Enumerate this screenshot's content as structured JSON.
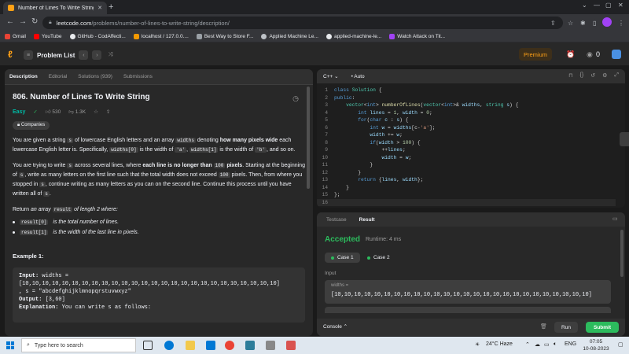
{
  "browser": {
    "tab_title": "Number of Lines To Write String",
    "url_host": "leetcode.com",
    "url_path": "/problems/number-of-lines-to-write-string/description/",
    "bookmarks": [
      {
        "label": "Gmail",
        "color": "#ea4335"
      },
      {
        "label": "YouTube",
        "color": "#ff0000"
      },
      {
        "label": "GitHub - CodAffecti...",
        "color": "#e8eaed"
      },
      {
        "label": "localhost / 127.0.0....",
        "color": "#f29900"
      },
      {
        "label": "Best Way to Store F...",
        "color": "#9aa0a6"
      },
      {
        "label": "Applied Machine Le...",
        "color": "#bdc1c6"
      },
      {
        "label": "applied-machine-le...",
        "color": "#e8eaed"
      },
      {
        "label": "Watch Attack on Tit...",
        "color": "#a142f4"
      }
    ]
  },
  "nav": {
    "problem_list": "Problem List",
    "premium": "Premium",
    "streak": "0"
  },
  "left": {
    "tabs": [
      "Description",
      "Editorial",
      "Solutions (939)",
      "Submissions"
    ],
    "title": "806. Number of Lines To Write String",
    "difficulty": "Easy",
    "likes": "530",
    "dislikes": "1.3K",
    "companies": "Companies",
    "p1": {
      "a": "You are given a string ",
      "b": "s",
      "c": " of lowercase English letters and an array ",
      "d": "widths",
      "e": " denoting ",
      "f": "how many pixels wide",
      "g": " each lowercase English letter is. Specifically, ",
      "h": "widths[0]",
      "i": " is the width of ",
      "j": "'a'",
      "k": ", ",
      "l": "widths[1]",
      "m": " is the width of ",
      "n": "'b'",
      "o": ", and so on."
    },
    "p2": {
      "a": "You are trying to write ",
      "b": "s",
      "c": " across several lines, where ",
      "d": "each line is no longer than ",
      "e": "100",
      "f": " pixels",
      "g": ". Starting at the beginning of ",
      "h": "s",
      "i": ", write as many letters on the first line such that the total width does not exceed ",
      "j": "100",
      "k": " pixels. Then, from where you stopped in ",
      "l": "s",
      "m": ", continue writing as many letters as you can on the second line. Continue this process until you have written all of ",
      "n": "s",
      "o": "."
    },
    "p3": {
      "a": "Return ",
      "b": "an array ",
      "c": "result",
      "d": " of length 2 where:"
    },
    "bullets": [
      {
        "code": "result[0]",
        "text": " is the total number of lines."
      },
      {
        "code": "result[1]",
        "text": " is the width of the last line in pixels."
      }
    ],
    "example_heading": "Example 1:",
    "example": {
      "input_label": "Input:",
      "input_a": " widths =",
      "input_b": "[10,10,10,10,10,10,10,10,10,10,10,10,10,10,10,10,10,10,10,10,10,10,10,10,10,10]",
      "input_c": ", s = \"abcdefghijklmnopqrstuvwxyz\"",
      "output_label": "Output:",
      "output": " [3,60]",
      "expl_label": "Explanation:",
      "expl": " You can write s as follows:"
    }
  },
  "editor": {
    "language": "C++",
    "mode": "Auto",
    "lines": [
      {
        "n": "1",
        "parts": [
          [
            "kw",
            "class "
          ],
          [
            "ty",
            "Solution "
          ],
          [
            "pl",
            "{"
          ]
        ]
      },
      {
        "n": "2",
        "parts": [
          [
            "kw",
            "public"
          ],
          [
            "pl",
            ":"
          ]
        ]
      },
      {
        "n": "3",
        "parts": [
          [
            "pl",
            "    "
          ],
          [
            "ty",
            "vector"
          ],
          [
            "pl",
            "<"
          ],
          [
            "kw",
            "int"
          ],
          [
            "pl",
            "> "
          ],
          [
            "fn",
            "numberOfLines"
          ],
          [
            "pl",
            "("
          ],
          [
            "ty",
            "vector"
          ],
          [
            "pl",
            "<"
          ],
          [
            "kw",
            "int"
          ],
          [
            "pl",
            ">& "
          ],
          [
            "ct",
            "widths"
          ],
          [
            "pl",
            ", "
          ],
          [
            "ty",
            "string "
          ],
          [
            "ct",
            "s"
          ],
          [
            "pl",
            ") {"
          ]
        ]
      },
      {
        "n": "4",
        "parts": [
          [
            "pl",
            "        "
          ],
          [
            "kw",
            "int "
          ],
          [
            "ct",
            "lines "
          ],
          [
            "pl",
            "= "
          ],
          [
            "nu",
            "1"
          ],
          [
            "pl",
            ", "
          ],
          [
            "ct",
            "width "
          ],
          [
            "pl",
            "= "
          ],
          [
            "nu",
            "0"
          ],
          [
            "pl",
            ";"
          ]
        ]
      },
      {
        "n": "5",
        "parts": [
          [
            "pl",
            "        "
          ],
          [
            "kw",
            "for"
          ],
          [
            "pl",
            "("
          ],
          [
            "kw",
            "char "
          ],
          [
            "ct",
            "c "
          ],
          [
            "pl",
            ": "
          ],
          [
            "ct",
            "s"
          ],
          [
            "pl",
            ") {"
          ]
        ]
      },
      {
        "n": "6",
        "parts": [
          [
            "pl",
            "            "
          ],
          [
            "kw",
            "int "
          ],
          [
            "ct",
            "w "
          ],
          [
            "pl",
            "= "
          ],
          [
            "ct",
            "widths"
          ],
          [
            "pl",
            "[c-"
          ],
          [
            "st",
            "'a'"
          ],
          [
            "pl",
            "];"
          ]
        ]
      },
      {
        "n": "7",
        "parts": [
          [
            "pl",
            "            "
          ],
          [
            "ct",
            "width "
          ],
          [
            "pl",
            "+= "
          ],
          [
            "ct",
            "w"
          ],
          [
            "pl",
            ";"
          ]
        ]
      },
      {
        "n": "8",
        "parts": [
          [
            "pl",
            "            "
          ],
          [
            "kw",
            "if"
          ],
          [
            "pl",
            "("
          ],
          [
            "ct",
            "width "
          ],
          [
            "pl",
            "> "
          ],
          [
            "nu",
            "100"
          ],
          [
            "pl",
            ") {"
          ]
        ]
      },
      {
        "n": "9",
        "parts": [
          [
            "pl",
            "                ++"
          ],
          [
            "ct",
            "lines"
          ],
          [
            "pl",
            ";"
          ]
        ]
      },
      {
        "n": "10",
        "parts": [
          [
            "pl",
            "                "
          ],
          [
            "ct",
            "width "
          ],
          [
            "pl",
            "= "
          ],
          [
            "ct",
            "w"
          ],
          [
            "pl",
            ";"
          ]
        ]
      },
      {
        "n": "11",
        "parts": [
          [
            "pl",
            "            }"
          ]
        ]
      },
      {
        "n": "12",
        "parts": [
          [
            "pl",
            "        }"
          ]
        ]
      },
      {
        "n": "13",
        "parts": [
          [
            "pl",
            "        "
          ],
          [
            "kw",
            "return "
          ],
          [
            "pl",
            "{"
          ],
          [
            "ct",
            "lines"
          ],
          [
            "pl",
            ", "
          ],
          [
            "ct",
            "width"
          ],
          [
            "pl",
            "};"
          ]
        ]
      },
      {
        "n": "14",
        "parts": [
          [
            "pl",
            "    }"
          ]
        ]
      },
      {
        "n": "15",
        "parts": [
          [
            "pl",
            "};"
          ]
        ]
      },
      {
        "n": "16",
        "parts": []
      }
    ]
  },
  "results": {
    "tabs": [
      "Testcase",
      "Result"
    ],
    "status": "Accepted",
    "runtime": "Runtime: 4 ms",
    "case1": "Case 1",
    "case2": "Case 2",
    "input_label": "Input",
    "var_name": "widths =",
    "var_value": "[10,10,10,10,10,10,10,10,10,10,10,10,10,10,10,10,10,10,10,10,10,10,10,10,10,10]",
    "console": "Console",
    "run": "Run",
    "submit": "Submit"
  },
  "taskbar": {
    "search_placeholder": "Type here to search",
    "weather": "24°C  Haze",
    "lang": "ENG",
    "time": "07:05",
    "date": "10-08-2023"
  }
}
